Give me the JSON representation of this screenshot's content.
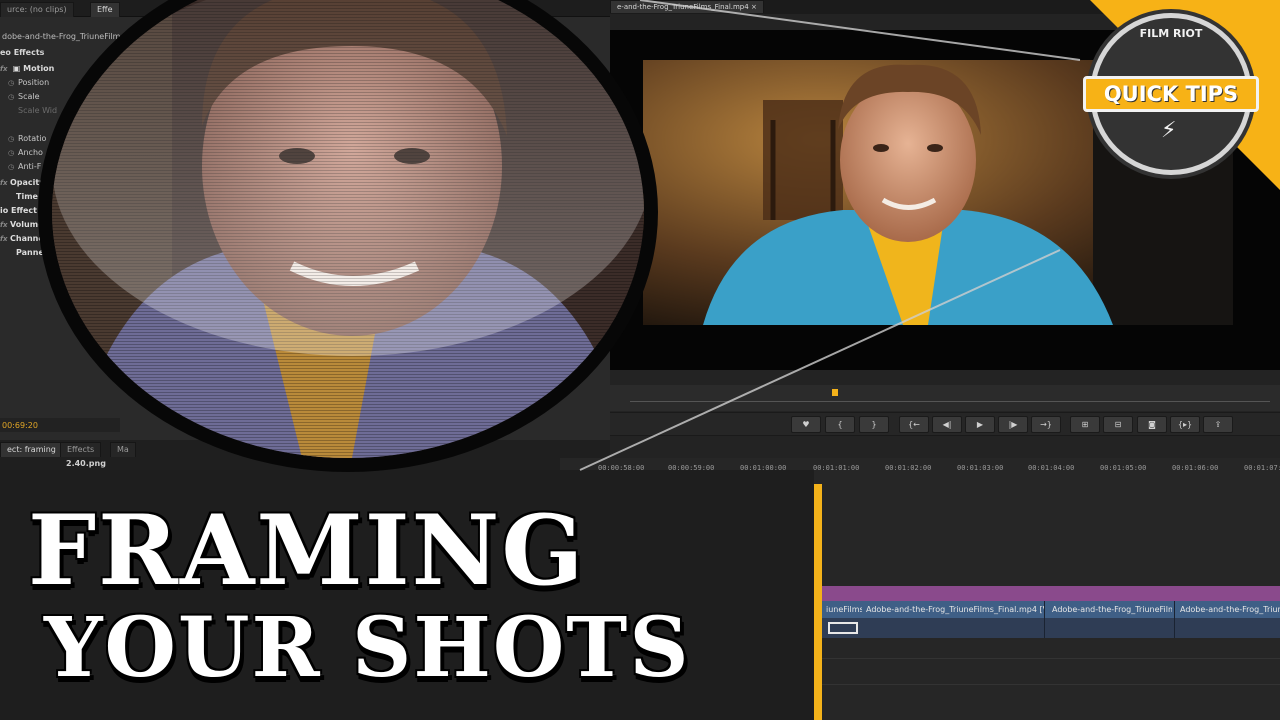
{
  "source_panel": {
    "tabs": [
      "urce: (no clips)",
      "Effe"
    ],
    "sequence_name": "dobe-and-the-Frog_TriuneFilm",
    "section_video_effects": "eo Effects",
    "effects": [
      {
        "label": "Motion",
        "bold": true
      },
      {
        "label": "Position",
        "bold": false
      },
      {
        "label": "Scale",
        "bold": false
      },
      {
        "label": "Scale Wid",
        "dim": true
      },
      {
        "label": "Rotatio",
        "bold": false
      },
      {
        "label": "Ancho",
        "bold": false
      },
      {
        "label": "Anti-F",
        "bold": false
      },
      {
        "label": "Opacity",
        "bold": true
      },
      {
        "label": "Time R",
        "bold": true
      },
      {
        "label": "io Effect",
        "bold": true
      },
      {
        "label": "Volume",
        "bold": true
      },
      {
        "label": "Channe",
        "bold": true
      },
      {
        "label": "Panner",
        "bold": true
      }
    ],
    "timecode": "00:69:20"
  },
  "project_panel": {
    "tabs": [
      "ect: framing",
      "Effects",
      "Ma"
    ],
    "file": "2.40.png"
  },
  "monitor": {
    "tab_label": "e-and-the-Frog_TriuneFilms_Final.mp4",
    "controls": [
      "♥",
      "{",
      "}",
      "{←",
      "◀|",
      "▶",
      "|▶",
      "→}",
      "⊞",
      "⊟",
      "◙",
      "{▸}",
      "⇪"
    ]
  },
  "timeline": {
    "timecodes": [
      "00:00:58:00",
      "00:00:59:00",
      "00:01:00:00",
      "00:01:01:00",
      "00:01:02:00",
      "00:01:03:00",
      "00:01:04:00",
      "00:01:05:00",
      "00:01:06:00",
      "00:01:07:"
    ],
    "clips": [
      {
        "label": "iuneFilms"
      },
      {
        "label": "Adobe-and-the-Frog_TriuneFilms_Final.mp4 [V"
      },
      {
        "label": "Adobe-and-the-Frog_TriuneFilm"
      },
      {
        "label": "Adobe-and-the-Frog_TriuneFilm"
      }
    ]
  },
  "title": {
    "line1": "FRAMING",
    "line2": "YOUR SHOTS"
  },
  "badge": {
    "brand": "FILM RIOT",
    "label": "QUICK TIPS"
  },
  "colors": {
    "accent": "#f7b216",
    "clip_purple": "#8a4a8c",
    "clip_blue": "#3f5f86"
  }
}
